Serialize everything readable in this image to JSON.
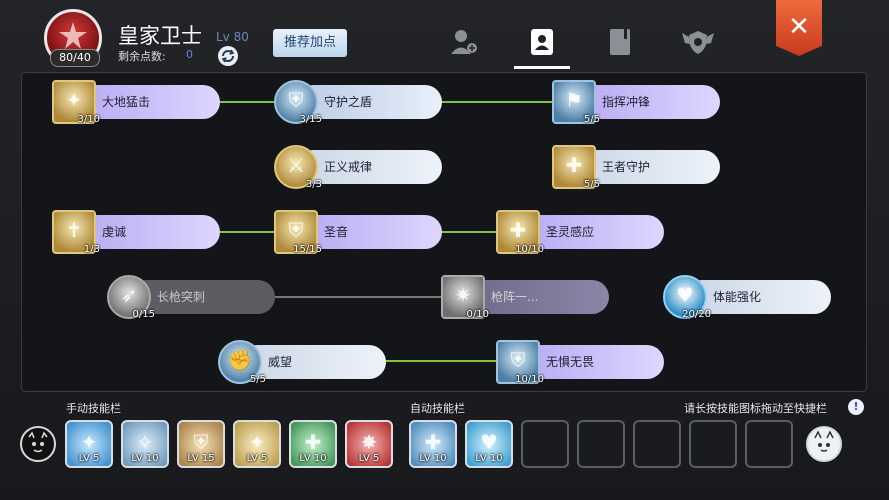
{
  "header": {
    "class_points": "80/40",
    "class_name": "皇家卫士",
    "level": "Lv 80",
    "remaining_label": "剩余点数:",
    "remaining_value": "0",
    "recommend_button": "推荐加点",
    "close_label": "✕",
    "tabs": [
      {
        "icon": "user-plus-icon"
      },
      {
        "icon": "contact-book-icon",
        "active": true
      },
      {
        "icon": "book-icon"
      },
      {
        "icon": "shield-wings-icon"
      }
    ]
  },
  "skills": [
    {
      "name": "大地猛击",
      "count": "3/10",
      "glyph": "✦"
    },
    {
      "name": "守护之盾",
      "count": "3/15",
      "glyph": "⛨"
    },
    {
      "name": "指挥冲锋",
      "count": "5/5",
      "glyph": "⚑"
    },
    {
      "name": "正义戒律",
      "count": "3/3",
      "glyph": "⚔"
    },
    {
      "name": "王者守护",
      "count": "5/5",
      "glyph": "✚"
    },
    {
      "name": "虔诚",
      "count": "1/3",
      "glyph": "✝"
    },
    {
      "name": "圣音",
      "count": "15/15",
      "glyph": "⛨"
    },
    {
      "name": "圣灵感应",
      "count": "10/10",
      "glyph": "✚"
    },
    {
      "name": "长枪突刺",
      "count": "0/15",
      "glyph": "➶"
    },
    {
      "name": "枪阵一...",
      "count": "0/10",
      "glyph": "✷"
    },
    {
      "name": "体能强化",
      "count": "20/20",
      "glyph": "♥"
    },
    {
      "name": "威望",
      "count": "5/5",
      "glyph": "✊"
    },
    {
      "name": "无惧无畏",
      "count": "10/10",
      "glyph": "⛨"
    }
  ],
  "bottom": {
    "manual_label": "手动技能栏",
    "auto_label": "自动技能栏",
    "hint": "请长按技能图标拖动至快捷栏",
    "info_icon": "!",
    "manual_slots": [
      {
        "lv": "LV 5",
        "glyph": "✦"
      },
      {
        "lv": "LV 10",
        "glyph": "✧"
      },
      {
        "lv": "LV 15",
        "glyph": "⛨"
      },
      {
        "lv": "LV 5",
        "glyph": "✦"
      },
      {
        "lv": "LV 10",
        "glyph": "✚"
      },
      {
        "lv": "LV 5",
        "glyph": "✸"
      }
    ],
    "auto_slots": [
      {
        "lv": "LV 10",
        "glyph": "✚"
      },
      {
        "lv": "LV 10",
        "glyph": "♥"
      }
    ]
  }
}
